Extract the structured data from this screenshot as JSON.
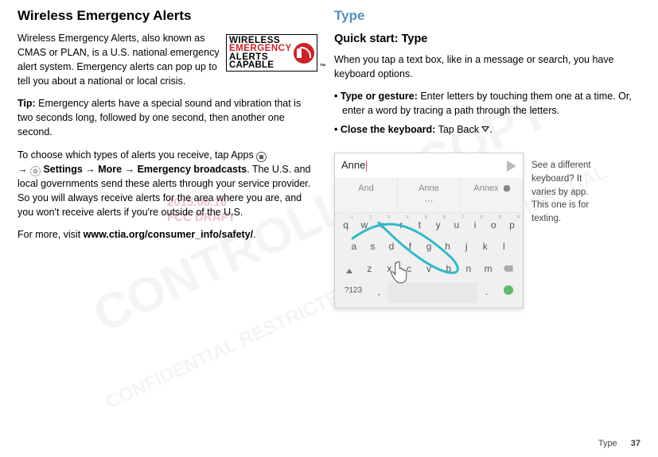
{
  "left": {
    "heading": "Wireless Emergency Alerts",
    "intro": "Wireless Emergency Alerts, also known as CMAS or PLAN, is a U.S. national emergency alert system. Emergency alerts can pop up to tell you about a national or local crisis.",
    "logo": {
      "w1": "WIRELESS",
      "w2": "EMERGENCY",
      "w3": "ALERTS",
      "w4": "CAPABLE",
      "tm": "™"
    },
    "tip_label": "Tip:",
    "tip_text": " Emergency alerts have a special sound and vibration that is two seconds long, followed by one second, then another one second.",
    "choose_pre": "To choose which types of alerts you receive, tap Apps ",
    "choose_arrow": " → ",
    "settings": "Settings",
    "more": "More",
    "eb": "Emergency broadcasts",
    "choose_post": ". The U.S. and local governments send these alerts through your service provider. So you will always receive alerts for the area where you are, and you won't receive alerts if you're outside of the U.S.",
    "more_pre": "For more, visit ",
    "more_link": "www.ctia.org/consumer_info/safety/",
    "more_post": "."
  },
  "right": {
    "heading": "Type",
    "sub": "Quick start: Type",
    "intro": "When you tap a text box, like in a message or search, you have keyboard options.",
    "b1_label": "Type or gesture:",
    "b1_text": " Enter letters by touching them one at a time. Or, enter a word by tracing a path through the letters.",
    "b2_label": "Close the keyboard:",
    "b2_text": " Tap Back ",
    "b2_post": ".",
    "note": "See a different keyboard? It varies by app. This one is for texting.",
    "phone": {
      "input": "Anne",
      "sugg1": "And",
      "sugg2": "Anne",
      "sugg3": "Annex",
      "row1": [
        "q",
        "w",
        "e",
        "r",
        "t",
        "y",
        "u",
        "i",
        "o",
        "p"
      ],
      "nums": [
        "1",
        "2",
        "3",
        "4",
        "5",
        "6",
        "7",
        "8",
        "9",
        "0"
      ],
      "row2": [
        "a",
        "s",
        "d",
        "f",
        "g",
        "h",
        "j",
        "k",
        "l"
      ],
      "row3": [
        "z",
        "x",
        "c",
        "v",
        "b",
        "n",
        "m"
      ],
      "sym": "?123"
    }
  },
  "draft": {
    "l1": "2015.06.16",
    "l2": "FCC DRAFT"
  },
  "footer": {
    "section": "Type",
    "page": "37"
  }
}
